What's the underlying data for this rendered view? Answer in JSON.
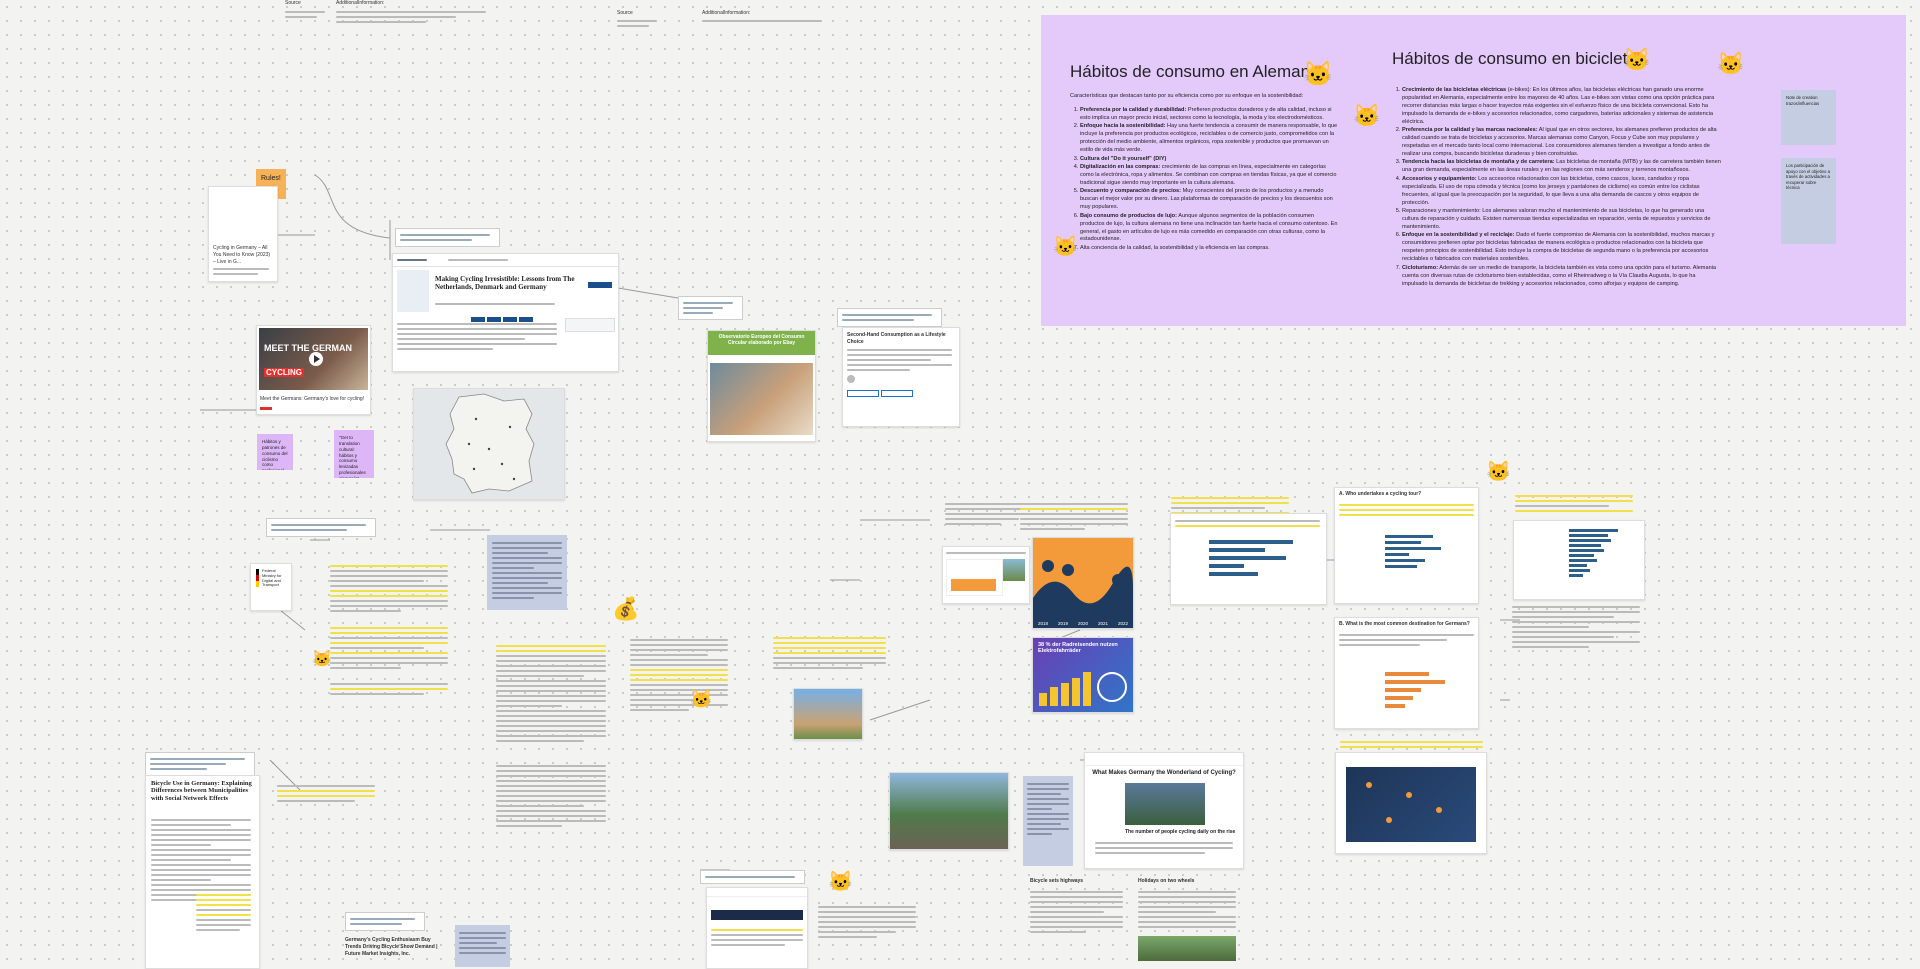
{
  "top_meta": {
    "source_1_label": "Source",
    "additional_info_1_label": "AdditionalInformation:",
    "source_2_label": "Source",
    "additional_info_2_label": "AdditionalInformation:"
  },
  "sticky_rules": "Rules!",
  "card_cycling_germany": {
    "title": "Cycling in Germany – All You Need to Know (2023) – Live in G..."
  },
  "video_card": {
    "thumb_text": "MEET THE GERMAN",
    "thumb_text_2": "CYCLING",
    "caption": "Meet the Germans: Germany's love for cycling!"
  },
  "paper_card": {
    "title": "Making Cycling Irresistible: Lessons from The Netherlands, Denmark and Germany"
  },
  "notes_left": {
    "purple_1": "Hábitos y patrones de consumo del ciclismo como profesional",
    "purple_2": "\"Get to translation cultural: hábitos y consumo lenizadas profesionales alemanía\""
  },
  "ministry": {
    "name": "Federal Ministry for Digital and Transport"
  },
  "green_card": {
    "title": "Observatorio Europeo del Consumo Circular elaborado por Ebay"
  },
  "second_hand_card": {
    "title": "Second-Hand Consumption as a Lifestyle Choice"
  },
  "purple_board": {
    "title_left": "Hábitos de consumo en Alemania",
    "intro_left": "Características que destacan tanto por su eficiencia como por su enfoque en la sostenibilidad:",
    "items_left": [
      {
        "bold": "Preferencia por la calidad y durabilidad:",
        "text": " Prefieren productos duraderos y de alta calidad, incluso si esto implica un mayor precio inicial, sectores como la tecnología, la moda y los electrodomésticos."
      },
      {
        "bold": "Enfoque hacia la sostenibilidad:",
        "text": " Hay una fuerte tendencia a consumir de manera responsable, lo que incluye la preferencia por productos ecológicos, reciclables o de comercio justo, comprometidos con la protección del medio ambiente, alimentos orgánicos, ropa sostenible y productos que promuevan un estilo de vida más verde."
      },
      {
        "bold": "Cultura del \"Do it yourself\" (DIY)",
        "text": ""
      },
      {
        "bold": "Digitalización en las compras:",
        "text": " crecimiento de las compras en línea, especialmente en categorías como la electrónica, ropa y alimentos. Se combinan con compras en tiendas físicas, ya que el comercio tradicional sigue siendo muy importante en la cultura alemana."
      },
      {
        "bold": "Descuento y comparación de precios:",
        "text": " Muy conscientes del precio de los productos y a menudo buscan el mejor valor por su dinero. Las plataformas de comparación de precios y los descuentos son muy populares."
      },
      {
        "bold": "Bajo consumo de productos de lujo:",
        "text": " Aunque algunos segmentos de la población consumen productos de lujo, la cultura alemana no tiene una inclinación tan fuerte hacia el consumo ostentoso. En general, el gasto en artículos de lujo es más comedido en comparación con otras culturas, como la estadounidense."
      },
      {
        "bold": "",
        "text": "Alta conciencia de la calidad, la sostenibilidad y la eficiencia en las compras."
      }
    ],
    "title_right": "Hábitos de consumo en bicicletas",
    "items_right": [
      {
        "bold": "Crecimiento de las bicicletas eléctricas",
        "text": " (e-bikes): En los últimos años, las bicicletas eléctricas han ganado una enorme popularidad en Alemania, especialmente entre los mayores de 40 años. Las e-bikes son vistas como una opción práctica para recorrer distancias más largas o hacer trayectos más exigentes sin el esfuerzo físico de una bicicleta convencional. Esto ha impulsado la demanda de e-bikes y accesorios relacionados, como cargadores, baterías adicionales y sistemas de asistencia eléctrica."
      },
      {
        "bold": "Preferencia por la calidad y las marcas nacionales:",
        "text": " Al igual que en otros sectores, los alemanes prefieren productos de alta calidad cuando se trata de bicicletas y accesorios. Marcas alemanas como Canyon, Focus y Cube son muy populares y respetadas en el mercado tanto local como internacional. Los consumidores alemanes tienden a investigar a fondo antes de realizar una compra, buscando bicicletas duraderas y bien construidas."
      },
      {
        "bold": "Tendencia hacia las bicicletas de montaña y de carretera:",
        "text": " Las bicicletas de montaña (MTB) y las de carretera también tienen una gran demanda, especialmente en las áreas rurales y en las regiones con más senderos y terrenos montañosos."
      },
      {
        "bold": "Accesorios y equipamiento:",
        "text": " Los accesorios relacionados con las bicicletas, como cascos, luces, candados y ropa especializada. El uso de ropa cómoda y técnica (como los jerseys y pantalones de ciclismo) es común entre los ciclistas frecuentes, al igual que la preocupación por la seguridad, lo que lleva a una alta demanda de cascos y otros equipos de protección."
      },
      {
        "bold": "",
        "text": "Reparaciones y mantenimiento: Los alemanes valoran mucho el mantenimiento de sus bicicletas, lo que ha generado una cultura de reparación y cuidado. Existen numerosas tiendas especializadas en reparación, venta de repuestos y servicios de mantenimiento."
      },
      {
        "bold": "Enfoque en la sostenibilidad y el reciclaje:",
        "text": " Dado el fuerte compromiso de Alemania con la sostenibilidad, muchos marcas y consumidores prefieren optar por bicicletas fabricadas de manera ecológica o productos relacionados con la bicicleta que respeten principios de sostenibilidad. Esto incluye la compra de bicicletas de segunda mano o la preferencia por accesorios reciclables o fabricados con materiales sostenibles."
      },
      {
        "bold": "Cicloturismo:",
        "text": " Además de ser un medio de transporte, la bicicleta también es vista como una opción para el turismo. Alemania cuenta con diversas rutas de cicloturismo bien establecidas, como el Rheinradweg o la Vía Claudia Augusta, lo que ha impulsado la demanda de bicicletas de trekking y accesorios relacionados, como alforjas y equipos de camping."
      }
    ],
    "side_note_1": "Note de creation trazos/influencias",
    "side_note_2": "Los participación de apoyo con el objetivo a través de actividades a recuperar sobre técnica"
  },
  "charts_mid": {
    "chart_labels": [
      "2018",
      "2019",
      "2020",
      "2021",
      "2022"
    ],
    "gradient_title": "38 % der Radreisenden nutzen Elektrofahrräder",
    "q4_title": "A. Who undertakes a cycling tour?",
    "q8_title": "B. What is the most common destination for Germans?"
  },
  "bottom_paper": {
    "title": "Bicycle Use in Germany: Explaining Differences between Municipalities with Social Network Effects"
  },
  "bottom_article": {
    "title": "Germany's Cycling Enthusiasm Buy Trends Driving Bicycle Show Demand | Future Market Insights, Inc."
  },
  "wonderland_card": {
    "title": "What Makes Germany the Wonderland of Cycling?",
    "subtitle": "The number of people cycling daily on the rise"
  },
  "spring_note": {
    "title": "Bicycle sets highways"
  },
  "holiday_note": {
    "title": "Holidays on two wheels"
  },
  "colors": {
    "board_purple": "#e4c9fb",
    "sticky_orange": "#f7b157",
    "sticky_purple": "#dcb6f6",
    "sticky_blue": "#c5cde2",
    "highlight": "#fbef6a"
  }
}
